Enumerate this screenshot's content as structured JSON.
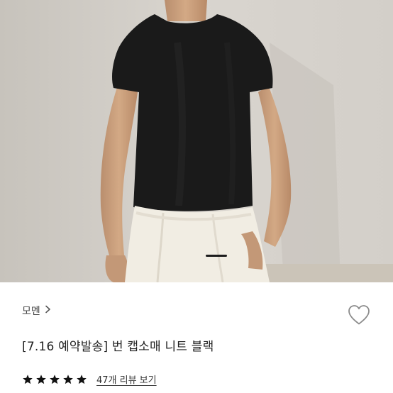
{
  "product": {
    "brand": "모멘",
    "brand_chevron_icon": "chevron-right-icon",
    "title": "[7.16 예약발송] 번 캡소매 니트 블랙",
    "rating": {
      "stars": 5,
      "max": 5
    },
    "review_link": "47개 리뷰 보기",
    "wishlist_icon": "heart-outline-icon"
  },
  "gallery": {
    "current_indicator_icon": "slide-indicator-bar"
  },
  "colors": {
    "star": "#111111",
    "heart_stroke": "#8c8c8c",
    "knit": "#1a1a1a",
    "pants": "#f1ede3"
  }
}
